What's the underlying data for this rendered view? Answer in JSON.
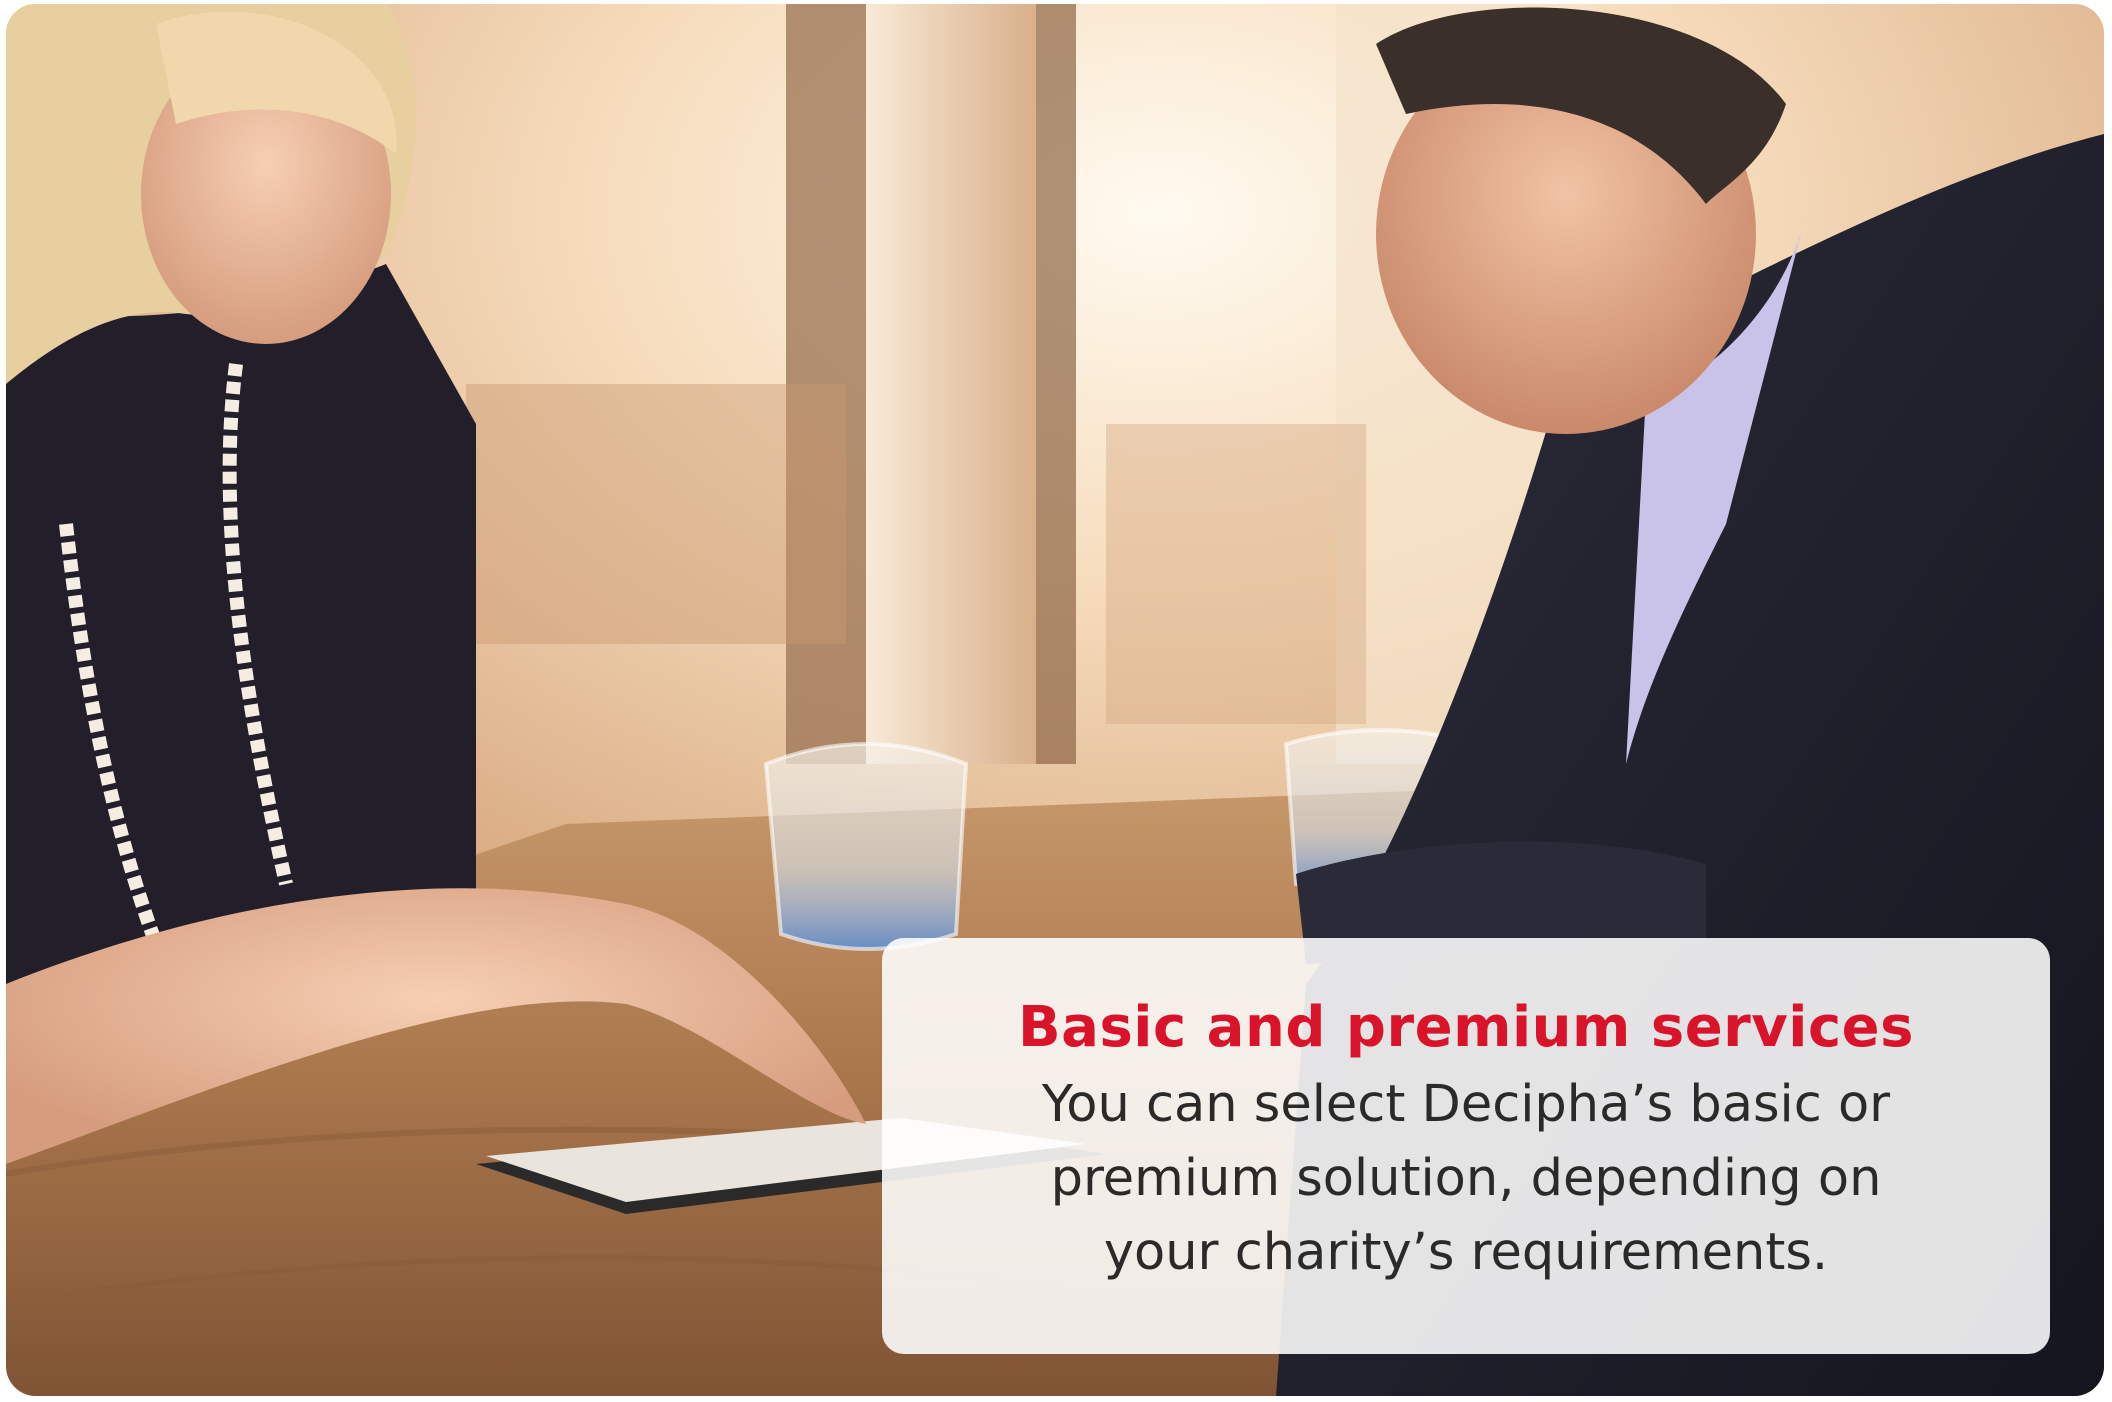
{
  "photo": {
    "subject": "two-people-reviewing-tablet-icon",
    "colors": {
      "window_glow": "#fff4e3",
      "wall_warm": "#e9c7a2",
      "table_wood": "#b9855a",
      "dress": "#221f2a",
      "suit": "#1c1c28",
      "shirt": "#c9c3ea",
      "skin": "#e8b898",
      "hair": "#e8cfa0"
    }
  },
  "caption": {
    "heading": "Basic and premium services",
    "body_lines": [
      "You can select Decipha’s basic or",
      "premium solution, depending on",
      "your charity’s requirements."
    ],
    "heading_color": "#d8132a",
    "body_color": "#2b2a29",
    "card_color": "#ffffff"
  }
}
